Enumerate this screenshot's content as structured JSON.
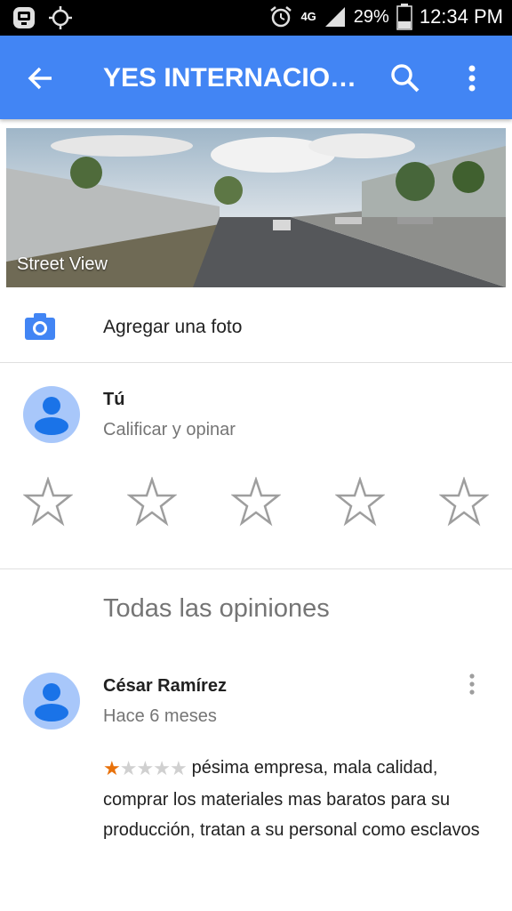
{
  "status_bar": {
    "network": "4G",
    "battery": "29%",
    "time": "12:34 PM"
  },
  "app_bar": {
    "title": "YES INTERNACIONAL",
    "back_icon": "arrow-back-icon",
    "search_icon": "search-icon",
    "more_icon": "more-vert-icon",
    "color": "#4285f4"
  },
  "street_view": {
    "label": "Street View"
  },
  "add_photo": {
    "icon": "camera-icon",
    "label": "Agregar una foto"
  },
  "your_review": {
    "name": "Tú",
    "prompt": "Calificar y opinar",
    "stars": [
      1,
      2,
      3,
      4,
      5
    ]
  },
  "all_reviews": {
    "heading": "Todas las opiniones"
  },
  "reviews": [
    {
      "author": "César Ramírez",
      "time": "Hace 6 meses",
      "rating": 1,
      "max_rating": 5,
      "text": "pésima empresa, mala calidad, comprar los materiales mas baratos para su producción, tratan a su personal como esclavos"
    }
  ]
}
